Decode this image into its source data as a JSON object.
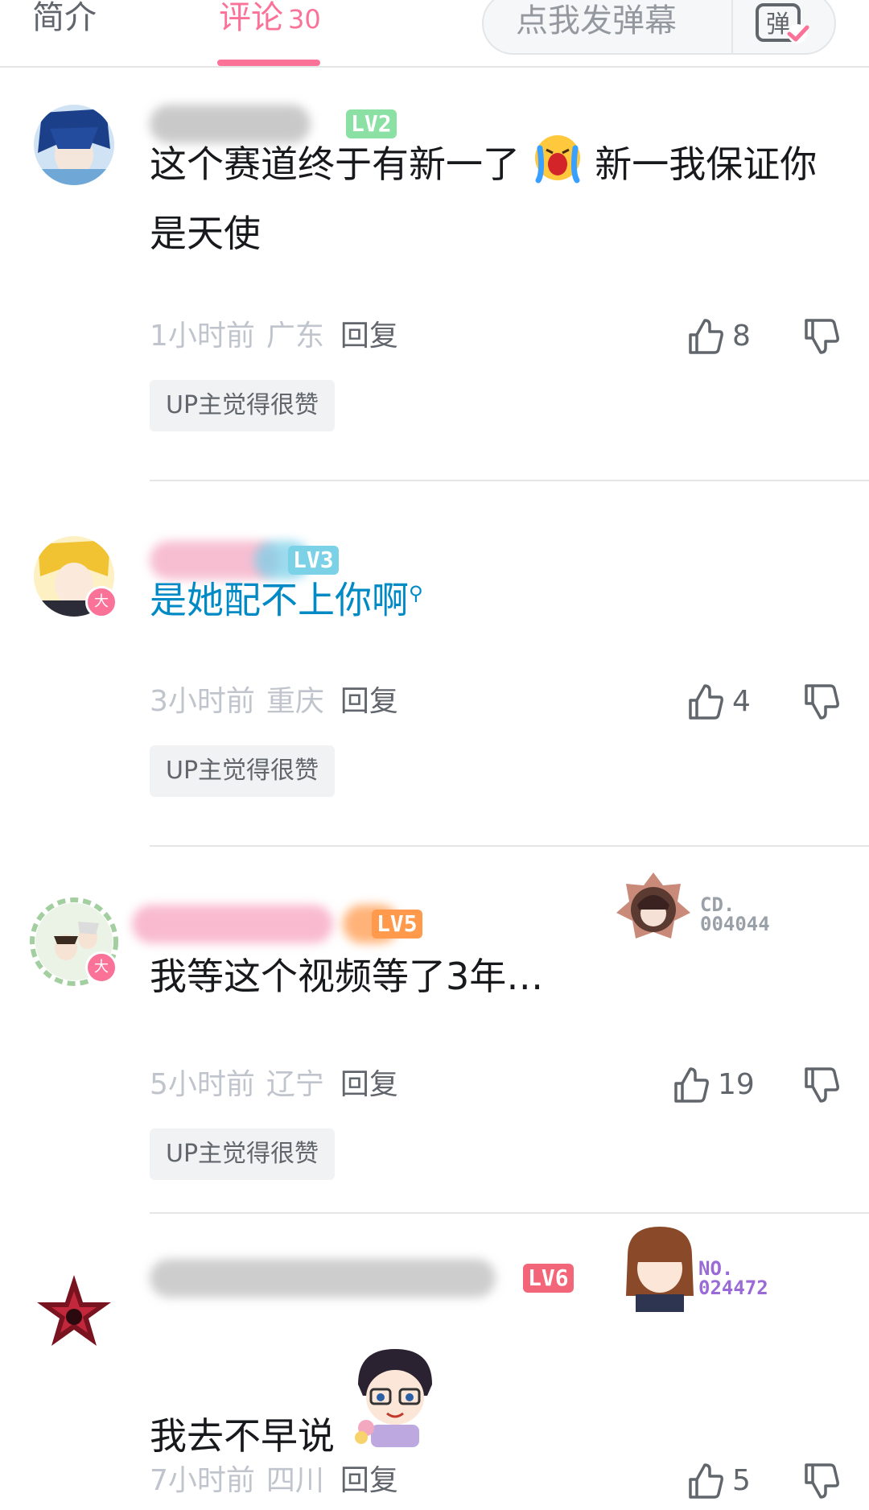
{
  "tabs": {
    "intro": "简介",
    "comments": "评论",
    "comments_count": "30"
  },
  "danmaku": {
    "placeholder": "点我发弹幕",
    "button_icon": "danmaku-toggle-icon",
    "button_char": "弹"
  },
  "comments": [
    {
      "level": "LV2",
      "level_color": "#8be0a4",
      "content_before_emoji": "这个赛道终于有新一了",
      "emoji": "crying-face-emoji",
      "content_after_emoji": "新一我保证你是天使",
      "time": "1小时前",
      "location": "广东",
      "reply": "回复",
      "likes": "8",
      "up_tag": "UP主觉得很赞"
    },
    {
      "level": "LV3",
      "level_color": "#7bd1e6",
      "content_link": "是她配不上你啊",
      "time": "3小时前",
      "location": "重庆",
      "reply": "回复",
      "likes": "4",
      "up_tag": "UP主觉得很赞",
      "vip_char": "大"
    },
    {
      "level": "LV5",
      "level_color": "#ff9a4d",
      "content": "我等这个视频等了3年…",
      "fan_no": "CD.\n004044",
      "time": "5小时前",
      "location": "辽宁",
      "reply": "回复",
      "likes": "19",
      "up_tag": "UP主觉得很赞",
      "vip_char": "大"
    },
    {
      "level": "LV6",
      "level_color": "#f3667a",
      "content": "我去不早说",
      "fan_no": "NO.\n024472",
      "time": "7小时前",
      "location": "四川",
      "reply": "回复",
      "likes": "5"
    }
  ],
  "colors": {
    "accent": "#fb7299",
    "link": "#008ac5",
    "meta": "#c0c4cc",
    "fan_no_purple": "#9a6bd6"
  }
}
